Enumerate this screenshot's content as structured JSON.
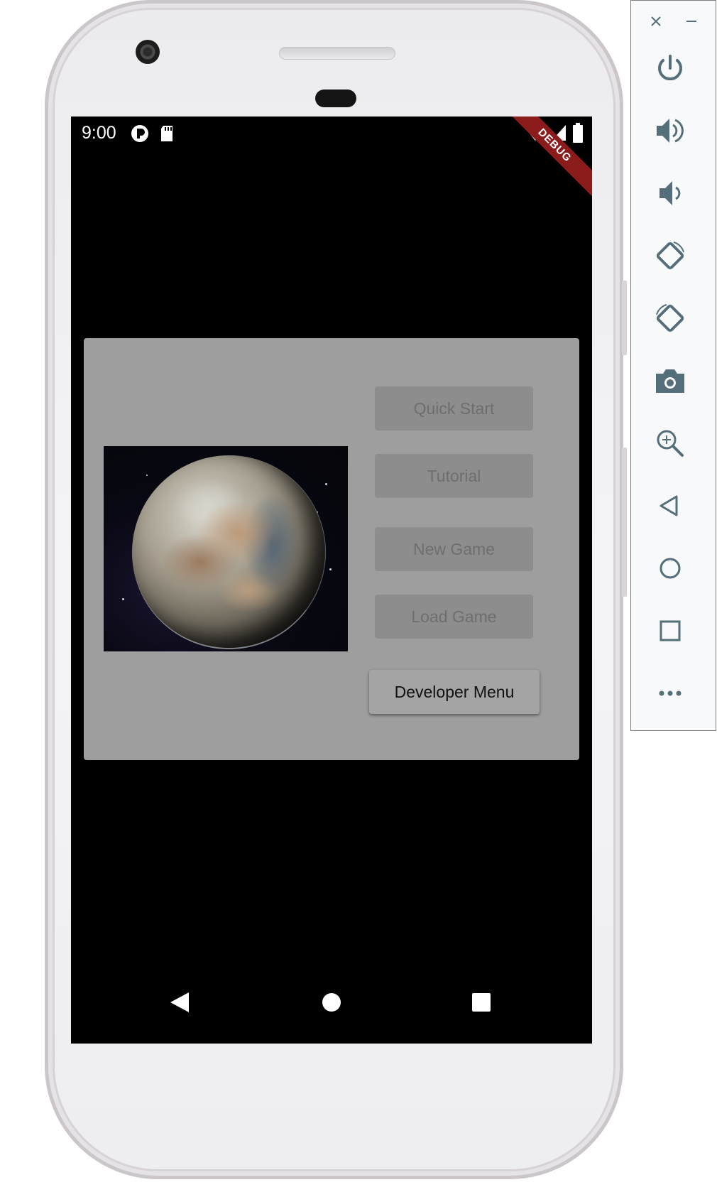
{
  "status_bar": {
    "time": "9:00",
    "icons": [
      "flutter-app-icon",
      "sd-card-icon",
      "wifi-icon",
      "cell-signal-icon",
      "battery-icon"
    ],
    "debug_banner": "DEBUG"
  },
  "menu": {
    "image": "planet-image",
    "buttons": {
      "quick_start": "Quick Start",
      "tutorial": "Tutorial",
      "new_game": "New Game",
      "load_game": "Load Game",
      "developer_menu": "Developer Menu"
    },
    "disabled_buttons": [
      "Quick Start",
      "Tutorial",
      "New Game",
      "Load Game"
    ]
  },
  "nav_bar": {
    "buttons": [
      "back-icon",
      "home-icon",
      "recents-icon"
    ]
  },
  "emulator_toolbar": {
    "buttons": [
      "close-icon",
      "minimize-icon",
      "power-icon",
      "volume-up-icon",
      "volume-down-icon",
      "rotate-left-icon",
      "rotate-right-icon",
      "camera-icon",
      "zoom-icon",
      "back-icon",
      "home-icon",
      "overview-icon",
      "more-icon"
    ]
  },
  "colors": {
    "panel": "#9e9e9e",
    "button_disabled": "#8d8d8d",
    "button_enabled": "#a4a4a4",
    "debug_banner": "#8c1c1c",
    "toolbar_icon": "#546e7a"
  }
}
